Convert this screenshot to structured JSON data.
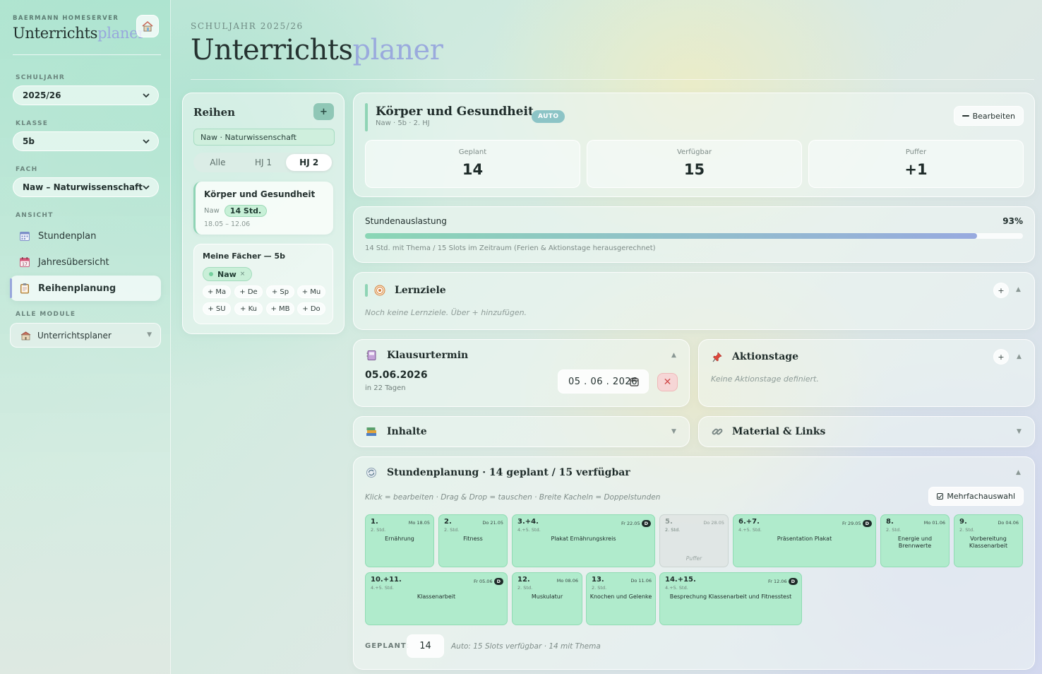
{
  "sidebar": {
    "brand_kicker": "BAERMANN HOMESERVER",
    "brand_title_a": "Unterrichts",
    "brand_title_b": "planer",
    "labels": {
      "schuljahr": "SCHULJAHR",
      "klasse": "KLASSE",
      "fach": "FACH",
      "ansicht": "ANSICHT",
      "alle_module": "ALLE MODULE"
    },
    "schuljahr_value": "2025/26",
    "klasse_value": "5b",
    "fach_value": "Naw – Naturwissenschaft",
    "nav": [
      {
        "label": "Stundenplan",
        "icon": "calendar-grid-icon"
      },
      {
        "label": "Jahresübersicht",
        "icon": "calendar-icon"
      },
      {
        "label": "Reihenplanung",
        "icon": "clipboard-icon",
        "active": true
      }
    ],
    "module_value": "Unterrichtsplaner"
  },
  "header": {
    "kicker": "SCHULJAHR 2025/26",
    "title_a": "Unterrichts",
    "title_b": "planer"
  },
  "reihen": {
    "title": "Reihen",
    "add_label": "+",
    "filter_label": "Naw · Naturwissenschaft",
    "tabs": [
      "Alle",
      "HJ 1",
      "HJ 2"
    ],
    "active_tab": "HJ 2",
    "item": {
      "title": "Körper und Gesundheit",
      "subject": "Naw",
      "hours": "14 Std.",
      "dates": "18.05 – 12.06"
    },
    "faecher": {
      "title": "Meine Fächer — 5b",
      "selected": "Naw",
      "remove_label": "×",
      "chips": [
        "+ Ma",
        "+ De",
        "+ Sp",
        "+ Mu",
        "+ SU",
        "+ Ku",
        "+ MB",
        "+ Do"
      ]
    }
  },
  "topic": {
    "title": "Körper und Gesundheit",
    "badge": "AUTO",
    "sub": "Naw · 5b · 2. HJ",
    "edit_label": "Bearbeiten",
    "stats": [
      {
        "label": "Geplant",
        "value": "14"
      },
      {
        "label": "Verfügbar",
        "value": "15"
      },
      {
        "label": "Puffer",
        "value": "+1"
      }
    ]
  },
  "auslastung": {
    "label": "Stundenauslastung",
    "percent_text": "93%",
    "fill_fraction": 0.93,
    "note": "14 Std. mit Thema / 15 Slots im Zeitraum (Ferien & Aktionstage herausgerechnet)"
  },
  "lernziele": {
    "title": "Lernziele",
    "empty": "Noch keine Lernziele. Über + hinzufügen.",
    "add_label": "+",
    "caret": "▲"
  },
  "klausur": {
    "title": "Klausurtermin",
    "date": "05.06.2026",
    "relative": "in 22 Tagen",
    "input_value": "05 . 06 . 2026",
    "caret": "▲",
    "delete_label": "✕"
  },
  "aktionstage": {
    "title": "Aktionstage",
    "empty": "Keine Aktionstage definiert.",
    "add_label": "+",
    "caret": "▲"
  },
  "inhalte": {
    "title": "Inhalte",
    "caret": "▼"
  },
  "material": {
    "title": "Material & Links",
    "caret": "▼"
  },
  "planung": {
    "title": "Stundenplanung · 14 geplant / 15 verfügbar",
    "caret": "▲",
    "hint": "Klick = bearbeiten · Drag & Drop = tauschen · Breite Kacheln = Doppelstunden",
    "multi_label": "Mehrfachauswahl",
    "tiles": [
      {
        "num": "1.",
        "meta": "2. Std.",
        "date": "Mo 18.05",
        "d": "",
        "topic": "Ernährung"
      },
      {
        "num": "2.",
        "meta": "2. Std.",
        "date": "Do 21.05",
        "d": "",
        "topic": "Fitness"
      },
      {
        "num": "3.+4.",
        "meta": "4.+5. Std.",
        "date": "Fr 22.05",
        "d": "D",
        "topic": "Plakat Ernährungskreis"
      },
      {
        "num": "5.",
        "meta": "2. Std.",
        "date": "Do 28.05",
        "d": "",
        "topic": "Puffer",
        "buffer": true
      },
      {
        "num": "6.+7.",
        "meta": "4.+5. Std.",
        "date": "Fr 29.05",
        "d": "D",
        "topic": "Präsentation Plakat"
      },
      {
        "num": "8.",
        "meta": "2. Std.",
        "date": "Mo 01.06",
        "d": "",
        "topic": "Energie und Brennwerte"
      },
      {
        "num": "9.",
        "meta": "2. Std.",
        "date": "Do 04.06",
        "d": "",
        "topic": "Vorbereitung Klassenarbeit"
      },
      {
        "num": "10.+11.",
        "meta": "4.+5. Std.",
        "date": "Fr 05.06",
        "d": "D",
        "topic": "Klassenarbeit"
      },
      {
        "num": "12.",
        "meta": "2. Std.",
        "date": "Mo 08.06",
        "d": "",
        "topic": "Muskulatur"
      },
      {
        "num": "13.",
        "meta": "2. Std.",
        "date": "Do 11.06",
        "d": "",
        "topic": "Knochen und Gelenke"
      },
      {
        "num": "14.+15.",
        "meta": "4.+5. Std.",
        "date": "Fr 12.06",
        "d": "D",
        "topic": "Besprechung Klassenarbeit und Fitnesstest"
      }
    ],
    "geplant_label": "GEPLANT:",
    "geplant_value": "14",
    "geplant_note": "Auto: 15 Slots verfügbar · 14 mit Thema"
  },
  "colors": {
    "accent": "#98a7dc",
    "green": "#8fd4b5",
    "tile": "#b0ebcc"
  }
}
